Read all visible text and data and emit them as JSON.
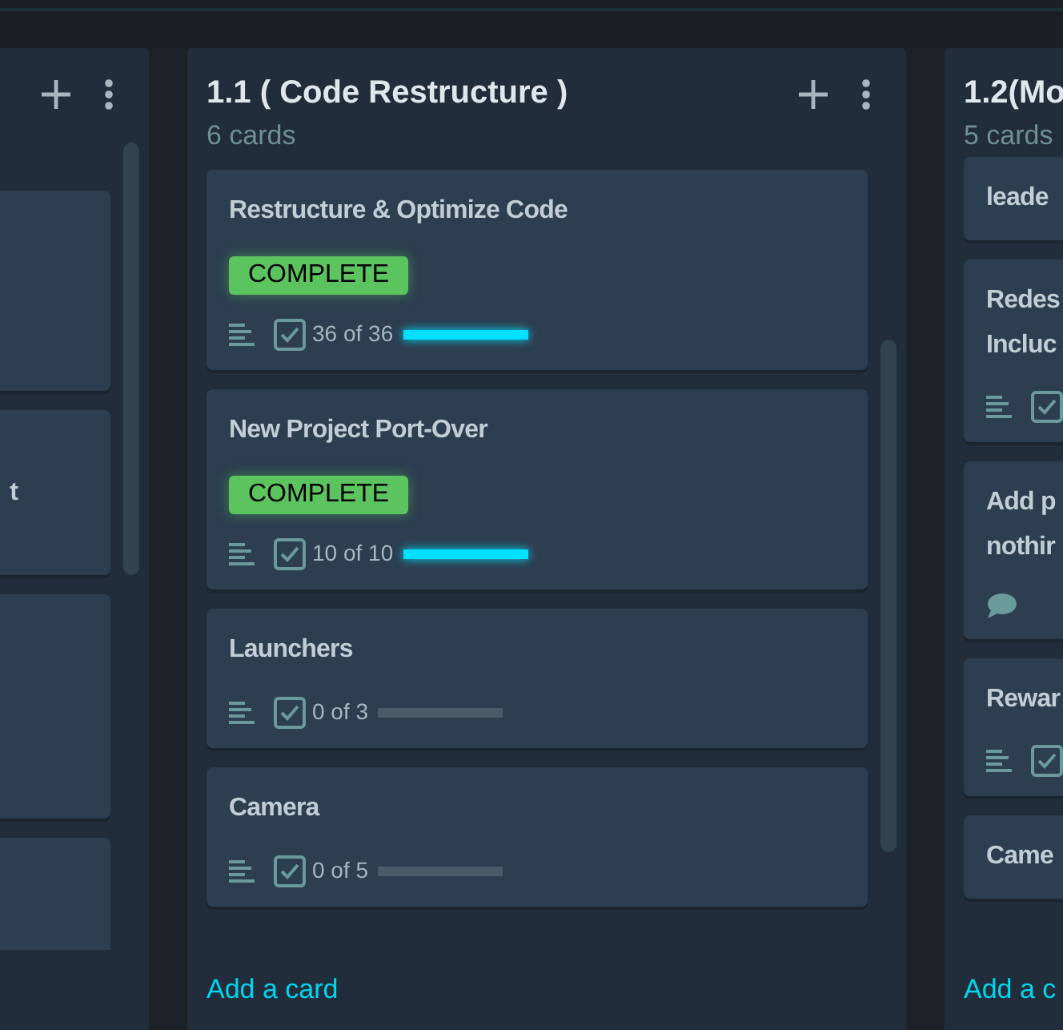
{
  "columns": [
    {
      "cards": [
        {
          "kind": "blank"
        },
        {
          "kind": "titled",
          "title_lines": [
            "t"
          ]
        },
        {
          "kind": "blank"
        },
        {
          "kind": "blank"
        }
      ]
    },
    {
      "title": "1.1 ( Code Restructure )",
      "count": "6 cards",
      "add_card": "Add a card",
      "cards": [
        {
          "kind": "titled",
          "title_lines": [
            "Restructure & Optimize Code"
          ],
          "label": "COMPLETE",
          "description": true,
          "checklist": {
            "text": "36 of 36",
            "level": 1
          },
          "comments": false
        },
        {
          "kind": "titled",
          "title_lines": [
            "New Project Port-Over"
          ],
          "label": "COMPLETE",
          "description": true,
          "checklist": {
            "text": "10 of 10",
            "level": 1
          },
          "comments": false
        },
        {
          "kind": "titled",
          "title_lines": [
            "Launchers"
          ],
          "description": true,
          "checklist": {
            "text": "0 of 3",
            "level": 0
          },
          "comments": false
        },
        {
          "kind": "titled",
          "title_lines": [
            "Camera"
          ],
          "description": true,
          "checklist": {
            "text": "0 of 5",
            "level": 0
          },
          "comments": false
        }
      ]
    },
    {
      "title": "1.2(Mo",
      "count": "5 cards",
      "add_card": "Add a c",
      "cards": [
        {
          "kind": "titled",
          "title_lines": [
            "leade"
          ]
        },
        {
          "kind": "titled",
          "title_lines": [
            "Redes",
            "Incluc"
          ],
          "description": true,
          "checklist": true,
          "comments": false
        },
        {
          "kind": "titled",
          "title_lines": [
            "Add p",
            "nothir"
          ],
          "description": false,
          "checklist": false,
          "comments": true
        },
        {
          "kind": "titled",
          "title_lines": [
            "Rewar"
          ],
          "description": true,
          "checklist": true,
          "comments": false
        },
        {
          "kind": "titled",
          "title_lines": [
            "Came"
          ]
        }
      ]
    }
  ]
}
